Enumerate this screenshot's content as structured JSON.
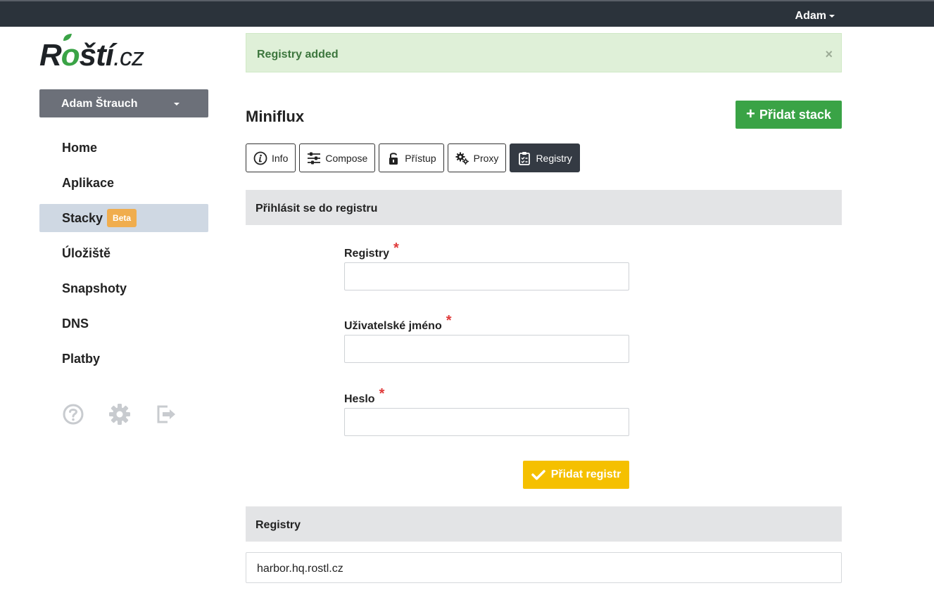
{
  "topbar": {
    "user": "Adam"
  },
  "logo": {
    "part1": "R",
    "part2": "o",
    "part3": "ští",
    "tld": ".cz"
  },
  "sidebar": {
    "account": "Adam Štrauch",
    "items": [
      {
        "label": "Home"
      },
      {
        "label": "Aplikace"
      },
      {
        "label": "Stacky",
        "badge": "Beta",
        "active": true
      },
      {
        "label": "Úložiště"
      },
      {
        "label": "Snapshoty"
      },
      {
        "label": "DNS"
      },
      {
        "label": "Platby"
      }
    ],
    "icons": [
      "help-icon",
      "gear-icon",
      "logout-icon"
    ]
  },
  "alert": {
    "message": "Registry added",
    "close": "×"
  },
  "page": {
    "title": "Miniflux",
    "add_stack": "Přidat stack"
  },
  "tabs": [
    {
      "label": "Info",
      "icon": "info-icon"
    },
    {
      "label": "Compose",
      "icon": "sliders-icon"
    },
    {
      "label": "Přístup",
      "icon": "lock-icon"
    },
    {
      "label": "Proxy",
      "icon": "gears-icon"
    },
    {
      "label": "Registry",
      "icon": "clipboard-icon",
      "active": true
    }
  ],
  "login_form": {
    "header": "Přihlásit se do registru",
    "fields": [
      {
        "label": "Registry",
        "required": "*",
        "value": ""
      },
      {
        "label": "Uživatelské jméno",
        "required": "*",
        "value": ""
      },
      {
        "label": "Heslo",
        "required": "*",
        "value": ""
      }
    ],
    "submit": "Přidat registr"
  },
  "registry_list": {
    "header": "Registry",
    "items": [
      "harbor.hq.rostl.cz"
    ]
  },
  "colors": {
    "accent_green": "#3aa346",
    "warning": "#f5c000",
    "badge": "#f0ad4e",
    "topbar": "#2b333b"
  }
}
